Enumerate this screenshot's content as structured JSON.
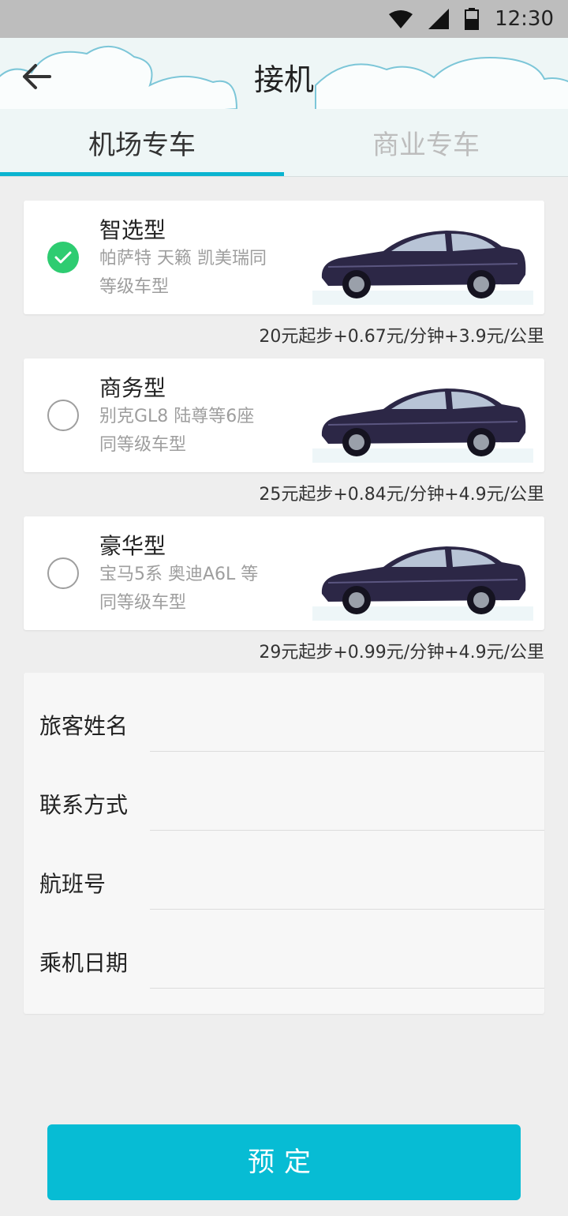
{
  "status_bar": {
    "time": "12:30",
    "icons": [
      "wifi-icon",
      "signal-icon",
      "battery-icon"
    ]
  },
  "header": {
    "title": "接机",
    "back_icon": "arrow-left-icon",
    "tabs": [
      {
        "label": "机场专车",
        "active": true
      },
      {
        "label": "商业专车",
        "active": false
      }
    ]
  },
  "cars": [
    {
      "name": "智选型",
      "desc_line1": "帕萨特 天籁 凯美瑞同",
      "desc_line2": "等级车型",
      "selected": true,
      "price": "20元起步+0.67元/分钟+3.9元/公里"
    },
    {
      "name": "商务型",
      "desc_line1": "别克GL8 陆尊等6座",
      "desc_line2": "同等级车型",
      "selected": false,
      "price": "25元起步+0.84元/分钟+4.9元/公里"
    },
    {
      "name": "豪华型",
      "desc_line1": "宝马5系 奥迪A6L 等",
      "desc_line2": "同等级车型",
      "selected": false,
      "price": "29元起步+0.99元/分钟+4.9元/公里"
    }
  ],
  "form": {
    "fields": [
      {
        "label": "旅客姓名",
        "value": ""
      },
      {
        "label": "联系方式",
        "value": ""
      },
      {
        "label": "航班号",
        "value": ""
      },
      {
        "label": "乘机日期",
        "value": ""
      }
    ]
  },
  "submit_label": "预定",
  "colors": {
    "accent": "#07bcd4",
    "check": "#2ecc71",
    "header_bg": "#eef6f6"
  }
}
